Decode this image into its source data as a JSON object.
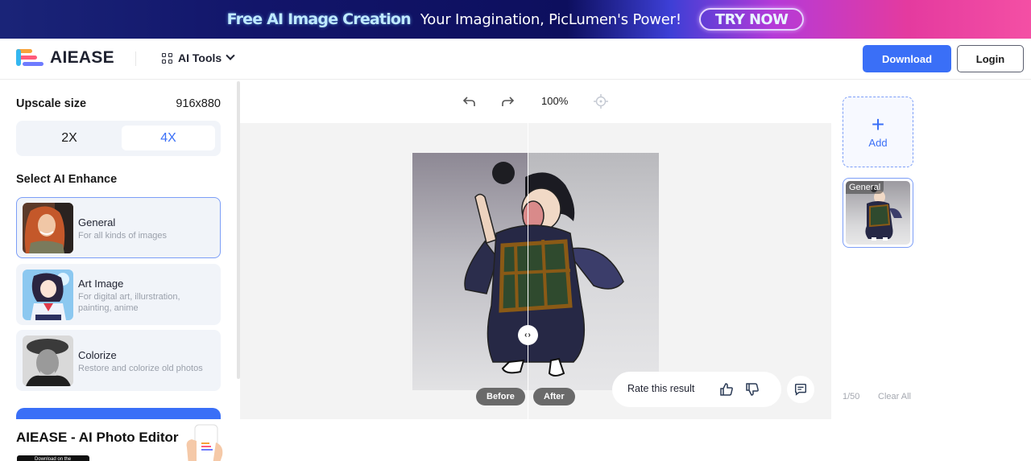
{
  "banner": {
    "title": "Free AI Image Creation",
    "subtitle": "Your Imagination, PicLumen's Power!",
    "cta": "TRY NOW"
  },
  "header": {
    "logo_text": "AIEASE",
    "tools_label": "AI Tools",
    "download_label": "Download",
    "login_label": "Login"
  },
  "left_panel": {
    "upscale_label": "Upscale size",
    "upscale_value": "916x880",
    "scale_options": [
      {
        "label": "2X",
        "selected": false
      },
      {
        "label": "4X",
        "selected": true
      }
    ],
    "enhance_label": "Select AI Enhance",
    "enhance_options": [
      {
        "title": "General",
        "desc": "For all kinds of images",
        "selected": true
      },
      {
        "title": "Art Image",
        "desc": "For digital art, illurstration, painting, anime",
        "selected": false
      },
      {
        "title": "Colorize",
        "desc": "Restore and colorize old photos",
        "selected": false
      }
    ],
    "promo_title": "AIEASE - AI Photo Editor",
    "store_badge": "Download on the"
  },
  "canvas": {
    "zoom": "100%",
    "before_label": "Before",
    "after_label": "After",
    "rate_label": "Rate this result",
    "split_position": 0.47
  },
  "right_panel": {
    "add_label": "Add",
    "history": [
      {
        "tag": "General"
      }
    ],
    "count": "1/50",
    "clear_label": "Clear All"
  },
  "colors": {
    "accent": "#3a6ff7",
    "selected_border": "#7c9ef7",
    "muted_text": "#9aa0ab"
  }
}
